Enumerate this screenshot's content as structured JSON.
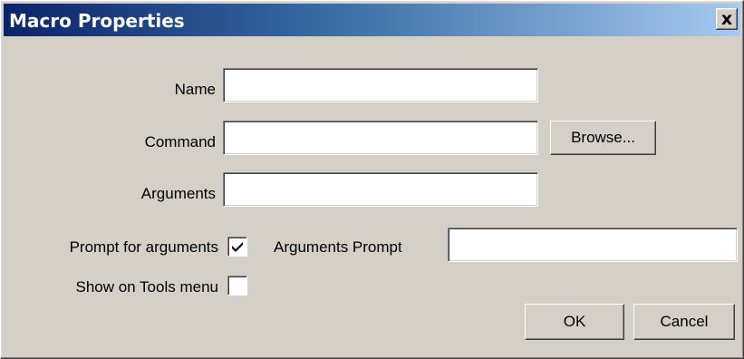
{
  "window": {
    "title": "Macro Properties",
    "close_glyph": "x"
  },
  "form": {
    "name_label": "Name",
    "name_value": "",
    "command_label": "Command",
    "command_value": "",
    "browse_label": "Browse...",
    "arguments_label": "Arguments",
    "arguments_value": "",
    "prompt_for_arguments_label": "Prompt for arguments",
    "prompt_for_arguments_checked": true,
    "arguments_prompt_label": "Arguments Prompt",
    "arguments_prompt_value": "",
    "show_on_tools_menu_label": "Show on Tools menu",
    "show_on_tools_menu_checked": false
  },
  "buttons": {
    "ok_label": "OK",
    "cancel_label": "Cancel"
  },
  "colors": {
    "dialog_bg": "#d4d0c8",
    "titlebar_start": "#0a246a",
    "titlebar_end": "#a6caf0"
  }
}
